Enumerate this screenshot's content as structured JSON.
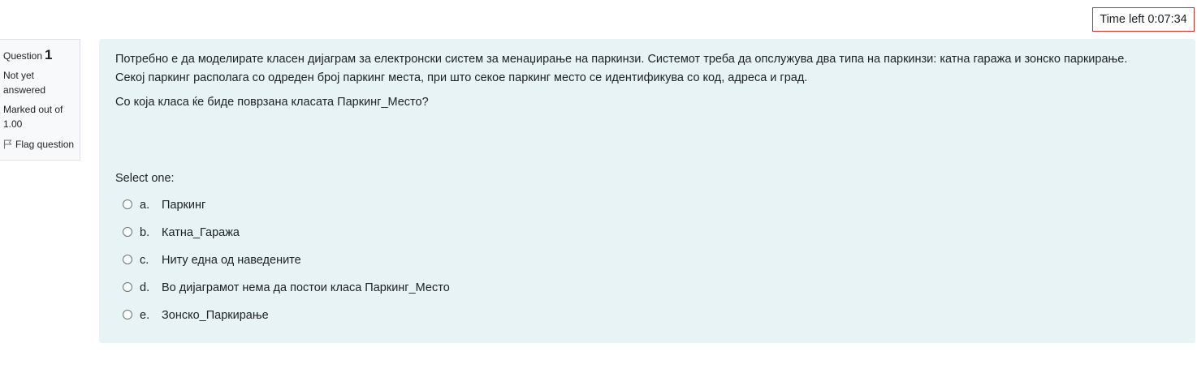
{
  "timer": {
    "text": "Time left 0:07:34"
  },
  "info": {
    "question_label": "Question",
    "question_number": "1",
    "state": "Not yet answered",
    "grade": "Marked out of 1.00",
    "flag_label": "Flag question",
    "flag_icon": "flag-icon"
  },
  "question": {
    "text_line1": "Потребно е да моделирате класен дијаграм за електронски систем за менаџирање на паркинзи. Системот треба да опслужува два типа на паркинзи: катна гаража и зонско паркирање.",
    "text_line2": "Секој паркинг располага со одреден број паркинг места, при што секое паркинг место се идентификува со код, адреса и град.",
    "text_question": "Со која класа ќе биде поврзана класата Паркинг_Место?",
    "prompt": "Select one:",
    "options": [
      {
        "letter": "a.",
        "label": "Паркинг"
      },
      {
        "letter": "b.",
        "label": "Катна_Гаража"
      },
      {
        "letter": "c.",
        "label": "Ниту една од наведените"
      },
      {
        "letter": "d.",
        "label": "Во дијаграмот нема да постои класа Паркинг_Место"
      },
      {
        "letter": "e.",
        "label": "Зонско_Паркирање"
      }
    ]
  },
  "colors": {
    "formulation_bg": "#e7f3f5",
    "timer_border": "#ca3120",
    "info_bg": "#f8f9fa"
  }
}
